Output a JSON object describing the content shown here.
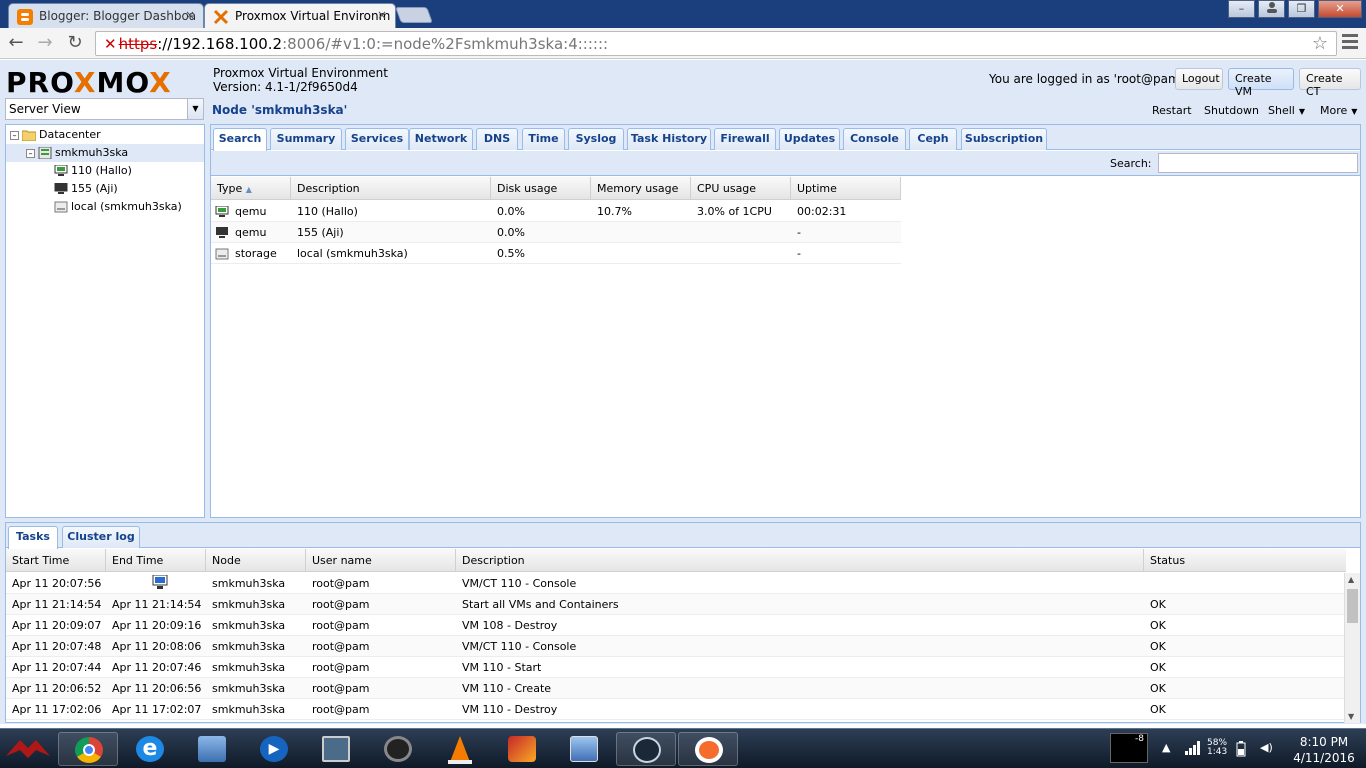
{
  "browser": {
    "tabs": [
      {
        "title": "Blogger: Blogger Dashboa",
        "close": "×"
      },
      {
        "title": "Proxmox Virtual Environm",
        "close": "×"
      }
    ],
    "url": {
      "https": "https",
      "host": "://192.168.100.2",
      "rest": ":8006/#v1:0:=node%2Fsmkmuh3ska:4::::::"
    },
    "window_controls": {
      "minimize": "–",
      "maximize": "❐",
      "close": "✕"
    }
  },
  "header": {
    "logo_pre": "PRO",
    "logo_x1": "X",
    "logo_mid": "MO",
    "logo_x2": "X",
    "title": "Proxmox Virtual Environment",
    "version": "Version: 4.1-1/2f9650d4",
    "login_text": "You are logged in as 'root@pam'",
    "logout": "Logout",
    "create_vm": "Create VM",
    "create_ct": "Create CT"
  },
  "view_selector": {
    "value": "Server View"
  },
  "tree": {
    "datacenter": "Datacenter",
    "node": "smkmuh3ska",
    "items": [
      "110 (Hallo)",
      "155 (Aji)",
      "local (smkmuh3ska)"
    ]
  },
  "node_panel": {
    "title": "Node 'smkmuh3ska'",
    "actions": {
      "restart": "Restart",
      "shutdown": "Shutdown",
      "shell": "Shell",
      "more": "More"
    },
    "tabs": [
      "Search",
      "Summary",
      "Services",
      "Network",
      "DNS",
      "Time",
      "Syslog",
      "Task History",
      "Firewall",
      "Updates",
      "Console",
      "Ceph",
      "Subscription"
    ],
    "search_label": "Search:",
    "columns": [
      "Type",
      "Description",
      "Disk usage",
      "Memory usage",
      "CPU usage",
      "Uptime"
    ],
    "sort_indicator": "▲",
    "rows": [
      {
        "type": "qemu",
        "description": "110 (Hallo)",
        "disk": "0.0%",
        "memory": "10.7%",
        "cpu": "3.0% of 1CPU",
        "uptime": "00:02:31"
      },
      {
        "type": "qemu",
        "description": "155 (Aji)",
        "disk": "0.0%",
        "memory": "",
        "cpu": "",
        "uptime": "-"
      },
      {
        "type": "storage",
        "description": "local (smkmuh3ska)",
        "disk": "0.5%",
        "memory": "",
        "cpu": "",
        "uptime": "-"
      }
    ]
  },
  "log_panel": {
    "tabs": [
      "Tasks",
      "Cluster log"
    ],
    "columns": [
      "Start Time",
      "End Time",
      "Node",
      "User name",
      "Description",
      "Status"
    ],
    "rows": [
      {
        "start": "Apr 11 20:07:56",
        "end": "",
        "node": "smkmuh3ska",
        "user": "root@pam",
        "description": "VM/CT 110 - Console",
        "status": ""
      },
      {
        "start": "Apr 11 21:14:54",
        "end": "Apr 11 21:14:54",
        "node": "smkmuh3ska",
        "user": "root@pam",
        "description": "Start all VMs and Containers",
        "status": "OK"
      },
      {
        "start": "Apr 11 20:09:07",
        "end": "Apr 11 20:09:16",
        "node": "smkmuh3ska",
        "user": "root@pam",
        "description": "VM 108 - Destroy",
        "status": "OK"
      },
      {
        "start": "Apr 11 20:07:48",
        "end": "Apr 11 20:08:06",
        "node": "smkmuh3ska",
        "user": "root@pam",
        "description": "VM/CT 110 - Console",
        "status": "OK"
      },
      {
        "start": "Apr 11 20:07:44",
        "end": "Apr 11 20:07:46",
        "node": "smkmuh3ska",
        "user": "root@pam",
        "description": "VM 110 - Start",
        "status": "OK"
      },
      {
        "start": "Apr 11 20:06:52",
        "end": "Apr 11 20:06:56",
        "node": "smkmuh3ska",
        "user": "root@pam",
        "description": "VM 110 - Create",
        "status": "OK"
      },
      {
        "start": "Apr 11 17:02:06",
        "end": "Apr 11 17:02:07",
        "node": "smkmuh3ska",
        "user": "root@pam",
        "description": "VM 110 - Destroy",
        "status": "OK"
      }
    ]
  },
  "taskbar": {
    "clock_time": "8:10 PM",
    "clock_date": "4/11/2016",
    "battery_pct": "58%",
    "battery_time": "1:43",
    "volume_badge": "-8",
    "colors": {
      "accent": "#e57000",
      "pve_blue": "#15428b",
      "pve_bg": "#dfe8f6"
    }
  }
}
